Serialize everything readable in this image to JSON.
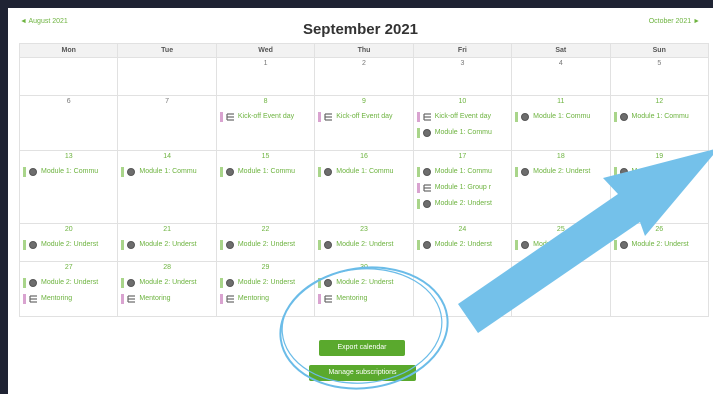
{
  "nav": {
    "prev_label": "August 2021",
    "next_label": "October 2021",
    "prev_arrow": "◄",
    "next_arrow": "►",
    "title": "September 2021"
  },
  "weekdays": [
    "Mon",
    "Tue",
    "Wed",
    "Thu",
    "Fri",
    "Sat",
    "Sun"
  ],
  "weeks": [
    [
      {
        "day": "",
        "events": []
      },
      {
        "day": "",
        "events": []
      },
      {
        "day": "1",
        "events": []
      },
      {
        "day": "2",
        "events": []
      },
      {
        "day": "3",
        "events": []
      },
      {
        "day": "4",
        "events": []
      },
      {
        "day": "5",
        "events": []
      }
    ],
    [
      {
        "day": "6",
        "events": []
      },
      {
        "day": "7",
        "events": []
      },
      {
        "day": "8",
        "events": [
          {
            "type": "course",
            "title": "Kick-off Event day"
          }
        ]
      },
      {
        "day": "9",
        "events": [
          {
            "type": "course",
            "title": "Kick-off Event day"
          }
        ]
      },
      {
        "day": "10",
        "events": [
          {
            "type": "course",
            "title": "Kick-off Event day"
          },
          {
            "type": "site",
            "title": "Module 1: Commu"
          }
        ]
      },
      {
        "day": "11",
        "events": [
          {
            "type": "site",
            "title": "Module 1: Commu"
          }
        ]
      },
      {
        "day": "12",
        "events": [
          {
            "type": "site",
            "title": "Module 1: Commu"
          }
        ]
      }
    ],
    [
      {
        "day": "13",
        "events": [
          {
            "type": "site",
            "title": "Module 1: Commu"
          }
        ]
      },
      {
        "day": "14",
        "events": [
          {
            "type": "site",
            "title": "Module 1: Commu"
          }
        ]
      },
      {
        "day": "15",
        "events": [
          {
            "type": "site",
            "title": "Module 1: Commu"
          }
        ]
      },
      {
        "day": "16",
        "events": [
          {
            "type": "site",
            "title": "Module 1: Commu"
          }
        ]
      },
      {
        "day": "17",
        "events": [
          {
            "type": "site",
            "title": "Module 1: Commu"
          },
          {
            "type": "course",
            "title": "Module 1: Group r"
          },
          {
            "type": "site",
            "title": "Module 2: Underst"
          }
        ]
      },
      {
        "day": "18",
        "events": [
          {
            "type": "site",
            "title": "Module 2: Underst"
          }
        ]
      },
      {
        "day": "19",
        "events": [
          {
            "type": "site",
            "title": "Module 2: Underst"
          }
        ]
      }
    ],
    [
      {
        "day": "20",
        "events": [
          {
            "type": "site",
            "title": "Module 2: Underst"
          }
        ]
      },
      {
        "day": "21",
        "events": [
          {
            "type": "site",
            "title": "Module 2: Underst"
          }
        ]
      },
      {
        "day": "22",
        "events": [
          {
            "type": "site",
            "title": "Module 2: Underst"
          }
        ]
      },
      {
        "day": "23",
        "events": [
          {
            "type": "site",
            "title": "Module 2: Underst"
          }
        ]
      },
      {
        "day": "24",
        "events": [
          {
            "type": "site",
            "title": "Module 2: Underst"
          }
        ]
      },
      {
        "day": "25",
        "events": [
          {
            "type": "site",
            "title": "Module 2: Underst"
          }
        ]
      },
      {
        "day": "26",
        "events": [
          {
            "type": "site",
            "title": "Module 2: Underst"
          }
        ]
      }
    ],
    [
      {
        "day": "27",
        "events": [
          {
            "type": "site",
            "title": "Module 2: Underst"
          },
          {
            "type": "course",
            "title": "Mentoring"
          }
        ]
      },
      {
        "day": "28",
        "events": [
          {
            "type": "site",
            "title": "Module 2: Underst"
          },
          {
            "type": "course",
            "title": "Mentoring"
          }
        ]
      },
      {
        "day": "29",
        "events": [
          {
            "type": "site",
            "title": "Module 2: Underst"
          },
          {
            "type": "course",
            "title": "Mentoring"
          }
        ]
      },
      {
        "day": "30",
        "events": [
          {
            "type": "site",
            "title": "Module 2: Underst"
          },
          {
            "type": "course",
            "title": "Mentoring"
          }
        ]
      },
      {
        "day": "",
        "events": []
      },
      {
        "day": "",
        "events": []
      },
      {
        "day": "",
        "events": []
      }
    ]
  ],
  "buttons": {
    "export": "Export calendar",
    "manage": "Manage subscriptions"
  },
  "icons": {
    "course_event": "list-icon",
    "site_event": "globe-icon"
  },
  "colors": {
    "background": "#1f2333",
    "accent_green": "#6db33f",
    "button_green": "#5aa92d",
    "course_bar": "#d9a3d0",
    "site_bar": "#a9d58a",
    "annotation_blue": "#6bbce8"
  }
}
